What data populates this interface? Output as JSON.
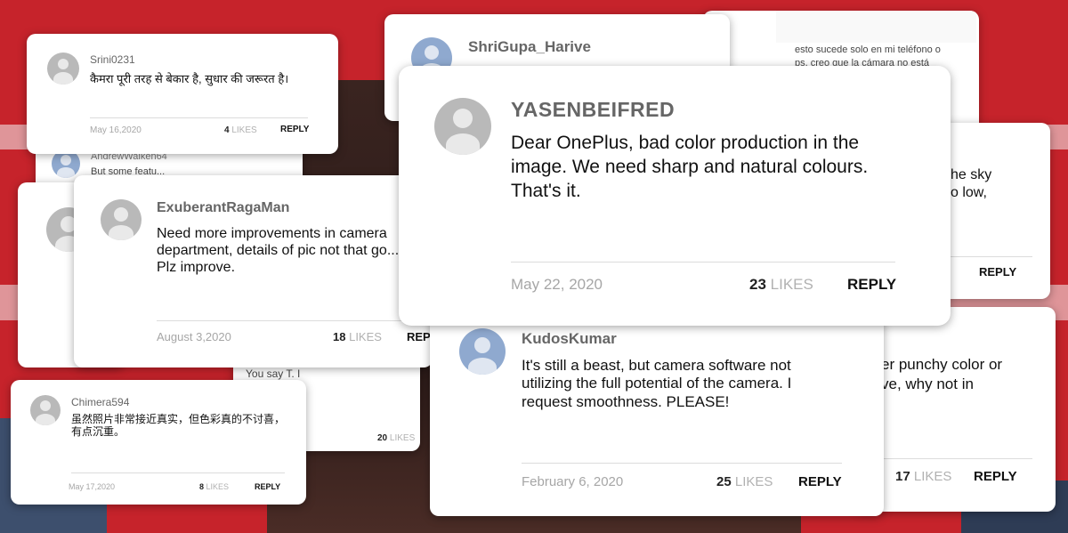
{
  "comments": {
    "srini": {
      "user": "Srini0231",
      "text": "कैमरा पूरी तरह से बेकार है, सुधार की जरूरत है।",
      "date": "May 16,2020",
      "likes": "4",
      "likes_label": "LIKES",
      "reply": "REPLY"
    },
    "andrew": {
      "user": "AndrewWalken64",
      "text": "But some featu..."
    },
    "shrigupa": {
      "user": "ShriGupa_Harive"
    },
    "spanish": {
      "line1": "esto sucede solo en mi teléfono o",
      "line2": "ps, creo que la cámara no está"
    },
    "yasen": {
      "user": "YASENBEIFRED",
      "text": "Dear OnePlus, bad color production in the image. We need sharp and natural colours. That's it.",
      "date": "May 22, 2020",
      "likes": "23",
      "likes_label": "LIKES",
      "reply": "REPLY"
    },
    "sky": {
      "line1": "he sky",
      "line2": "o low,",
      "reply": "REPLY"
    },
    "exuberant": {
      "user": "ExuberantRagaMan",
      "text": "Need more improvements in camera department, details of pic not that go... Plz improve.",
      "date": "August 3,2020",
      "likes": "18",
      "likes_label": "LIKES",
      "reply": "REP"
    },
    "kudos": {
      "user": "KudosKumar",
      "text": "It's still a beast, but camera software not utilizing the full potential of the camera. I request smoothness. PLEASE!",
      "date": "February 6, 2020",
      "likes": "25",
      "likes_label": "LIKES",
      "reply": "REPLY"
    },
    "punchy": {
      "line1": "er punchy color or",
      "line2": "ve, why not in",
      "likes": "17",
      "likes_label": "LIKES",
      "reply": "REPLY"
    },
    "chimera": {
      "user": "Chimera594",
      "text": "虽然照片非常接近真实，但色彩真的不讨喜，有点沉重。",
      "date": "May 17,2020",
      "likes": "8",
      "likes_label": "LIKES",
      "reply": "REPLY"
    },
    "hidden": {
      "text": "You say T. I ",
      "likes": "20",
      "likes_label": "LIKES"
    }
  }
}
